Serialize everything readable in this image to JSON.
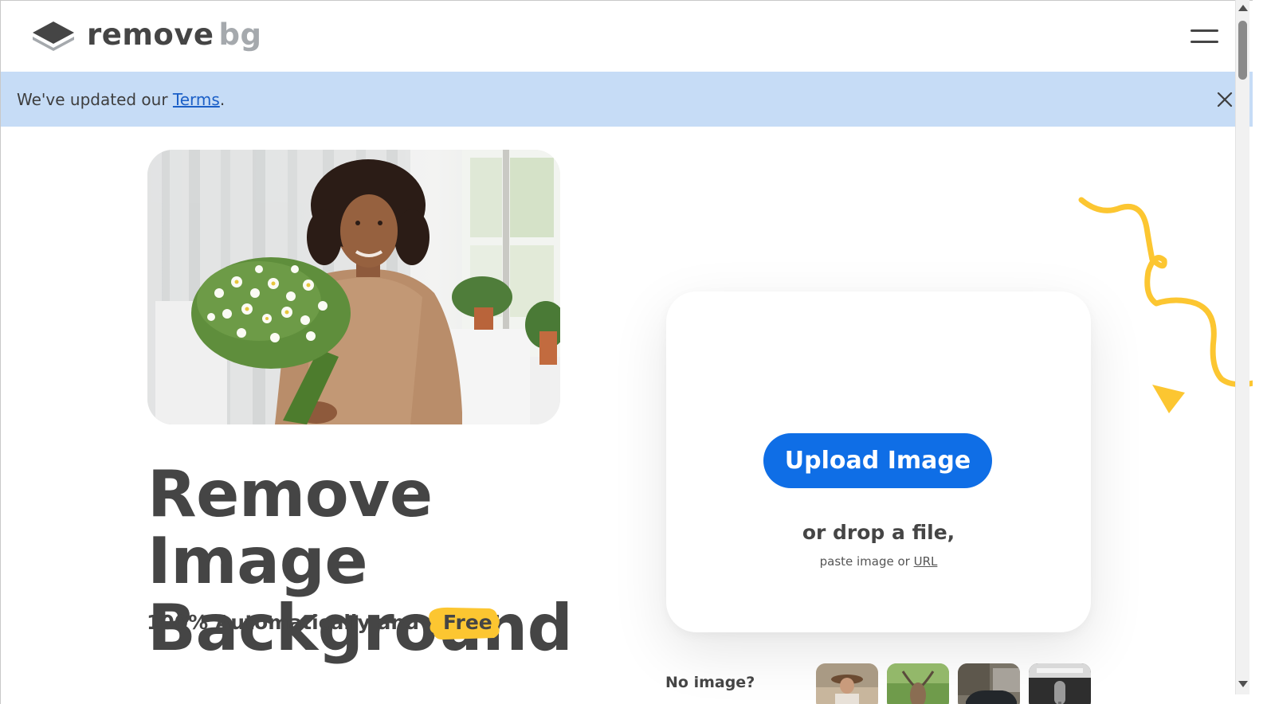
{
  "header": {
    "logo_word": "remove",
    "logo_suffix": "bg",
    "menu_icon": "hamburger-menu-icon"
  },
  "banner": {
    "text_prefix": "We've updated our ",
    "link_label": "Terms",
    "text_suffix": ".",
    "close_icon": "close-icon"
  },
  "hero": {
    "image_alt": "Woman holding a bouquet of white daisies",
    "headline_line1": "Remove Image",
    "headline_line2": "Background",
    "subline": "100% Automatically and",
    "badge": "Free"
  },
  "upload": {
    "button_label": "Upload Image",
    "drop_text": "or drop a file,",
    "paste_prefix": "paste image or ",
    "url_link": "URL"
  },
  "samples": {
    "label": "No image?",
    "thumbnails": [
      "woman-with-hat",
      "antelope",
      "car",
      "microphone"
    ]
  },
  "colors": {
    "primary": "#0f6ee6",
    "banner_bg": "#c6dcf6",
    "accent_yellow": "#fcc631",
    "text": "#454545"
  }
}
